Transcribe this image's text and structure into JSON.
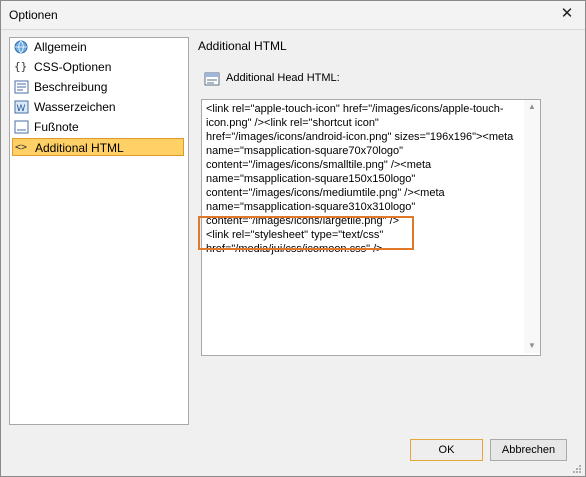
{
  "window": {
    "title": "Optionen"
  },
  "sidebar": {
    "items": [
      {
        "label": "Allgemein",
        "icon": "globe-icon"
      },
      {
        "label": "CSS-Optionen",
        "icon": "braces-icon"
      },
      {
        "label": "Beschreibung",
        "icon": "description-icon"
      },
      {
        "label": "Wasserzeichen",
        "icon": "watermark-icon"
      },
      {
        "label": "Fußnote",
        "icon": "footnote-icon"
      },
      {
        "label": "Additional HTML",
        "icon": "html-code-icon",
        "selected": true
      }
    ]
  },
  "main": {
    "section_title": "Additional HTML",
    "field_label": "Additional Head HTML:",
    "field_icon": "html-header-icon",
    "textarea_lines": [
      "<link rel=\"apple-touch-icon\" href=\"/images/icons/apple-touch-",
      "icon.png\" /><link rel=\"shortcut icon\"",
      "href=\"/images/icons/android-icon.png\" sizes=\"196x196\"><meta",
      "name=\"msapplication-square70x70logo\"",
      "content=\"/images/icons/smalltile.png\" /><meta",
      "name=\"msapplication-square150x150logo\"",
      "content=\"/images/icons/mediumtile.png\" /><meta",
      "name=\"msapplication-square310x310logo\"",
      "content=\"/images/icons/largetile.png\" />",
      "<link rel=\"stylesheet\" type=\"text/css\"",
      "href=\"/media/jui/css/icomoon.css\" />"
    ]
  },
  "buttons": {
    "ok": "OK",
    "cancel": "Abbrechen"
  },
  "colors": {
    "selection_fill": "#ffd066",
    "selection_border": "#e09a2b",
    "highlight_border": "#e0782a"
  }
}
